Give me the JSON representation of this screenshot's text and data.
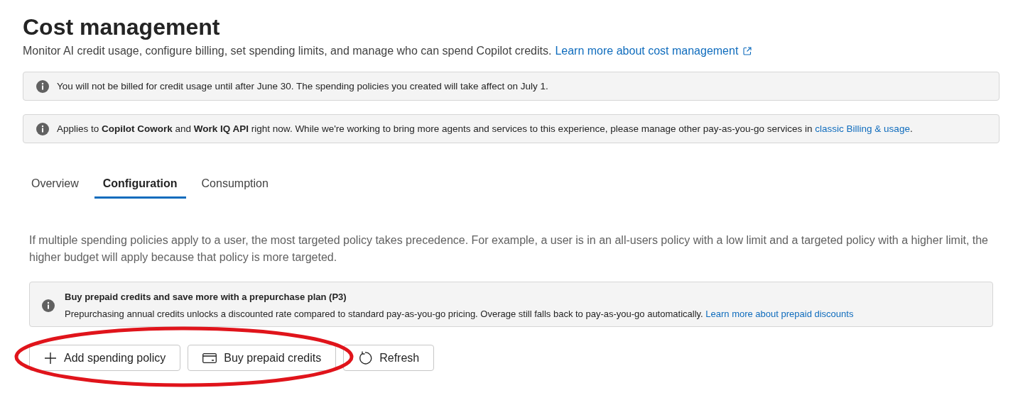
{
  "header": {
    "title": "Cost management",
    "subtitle": "Monitor AI credit usage, configure billing, set spending limits, and manage who can spend Copilot credits.",
    "link": "Learn more about cost management"
  },
  "banners": [
    {
      "text": "You will not be billed for credit usage until after June 30. The spending policies you created will take affect on July 1."
    },
    {
      "text": "Applies to **Copilot Cowork** and **Work IQ API** right now. While we're working to bring more agents and services to this experience, please manage other pay-as-you-go services in ",
      "link": "classic Billing & usage",
      "after": "."
    }
  ],
  "tabs": [
    {
      "label": "Overview",
      "selected": false
    },
    {
      "label": "Configuration",
      "selected": true
    },
    {
      "label": "Consumption",
      "selected": false
    }
  ],
  "description": "If multiple spending policies apply to a user, the most targeted policy takes precedence. For example, a user is in an all-users policy with a low limit and a targeted policy with a higher limit, the higher budget will apply because that policy is more targeted.",
  "info_card": {
    "title": "Buy prepaid credits and save more with a prepurchase plan (P3)",
    "text": "Prepurchasing annual credits unlocks a discounted rate compared to standard pay-as-you-go pricing. Overage still falls back to pay-as-you-go automatically.",
    "link": "Learn more about prepaid discounts"
  },
  "buttons": [
    {
      "label": "Add spending policy",
      "kind": "add"
    },
    {
      "label": "Buy prepaid credits",
      "kind": "buy"
    },
    {
      "label": "Refresh",
      "kind": "refresh"
    }
  ],
  "annotation": {
    "kind": "ellipse"
  }
}
